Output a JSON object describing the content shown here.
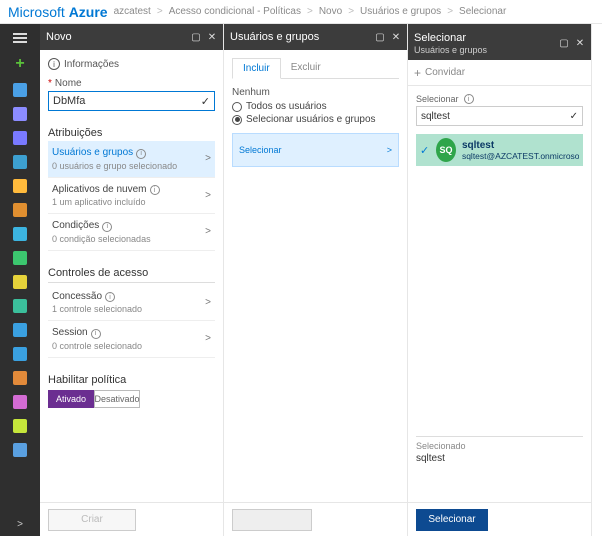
{
  "header": {
    "brand_pre": "Microsoft ",
    "brand_bold": "Azure",
    "crumbs": [
      "azcatest",
      "Acesso condicional - Políticas",
      "Novo",
      "Usuários e grupos",
      "Selecionar"
    ]
  },
  "rail": {
    "icons": [
      {
        "name": "apps-icon",
        "color": "#4aa0e6"
      },
      {
        "name": "grid-icon",
        "color": "#8c8cff"
      },
      {
        "name": "resource-icon",
        "color": "#7a7aff"
      },
      {
        "name": "globe-icon",
        "color": "#3da0d0"
      },
      {
        "name": "bolt-icon",
        "color": "#ffba3c"
      },
      {
        "name": "db-icon",
        "color": "#e08f30"
      },
      {
        "name": "cloud-icon",
        "color": "#3cb4e0"
      },
      {
        "name": "plus-icon",
        "color": "#3cc76f"
      },
      {
        "name": "sheet-icon",
        "color": "#e6d23a"
      },
      {
        "name": "swap-icon",
        "color": "#3bbf9b"
      },
      {
        "name": "people-icon",
        "color": "#3aa0e0"
      },
      {
        "name": "monitor-icon",
        "color": "#3aa0e0"
      },
      {
        "name": "shield-icon",
        "color": "#e28a3a"
      },
      {
        "name": "dot-icon",
        "color": "#d46cd4"
      },
      {
        "name": "ring-icon",
        "color": "#c5e63b"
      },
      {
        "name": "hex-icon",
        "color": "#5aa0e0"
      }
    ]
  },
  "blade1": {
    "title": "Novo",
    "info_label": "Informações",
    "name_label": "Nome",
    "name_value": "DbMfa",
    "assignments_title": "Atribuições",
    "items": [
      {
        "title": "Usuários e grupos",
        "sub": "0 usuários e grupo selecionado",
        "selected": true,
        "help": true
      },
      {
        "title": "Aplicativos de nuvem",
        "sub": "1 um aplicativo incluído",
        "help": true
      },
      {
        "title": "Condições",
        "sub": "0 condição selecionadas",
        "help": true
      }
    ],
    "access_title": "Controles de acesso",
    "access_items": [
      {
        "title": "Concessão",
        "sub": "1 controle selecionado",
        "help": true
      },
      {
        "title": "Session",
        "sub": "0 controle selecionado",
        "help": true
      }
    ],
    "enable_label": "Habilitar política",
    "toggle_on": "Ativado",
    "toggle_off": "Desativado",
    "create_btn": "Criar"
  },
  "blade2": {
    "title": "Usuários e grupos",
    "tab_include": "Incluir",
    "tab_exclude": "Excluir",
    "none_label": "Nenhum",
    "radio_all": "Todos os usuários",
    "radio_select": "Selecionar usuários e grupos",
    "select_card": "Selecionar"
  },
  "blade3": {
    "title": "Selecionar",
    "subtitle": "Usuários e grupos",
    "invite": "Convidar",
    "select_label": "Selecionar",
    "search_value": "sqltest",
    "result": {
      "initials": "SQ",
      "name": "sqltest",
      "email": "sqltest@AZCATEST.onmicrosoft.com"
    },
    "selected_label": "Selecionado",
    "selected_value": "sqltest",
    "select_btn": "Selecionar"
  }
}
